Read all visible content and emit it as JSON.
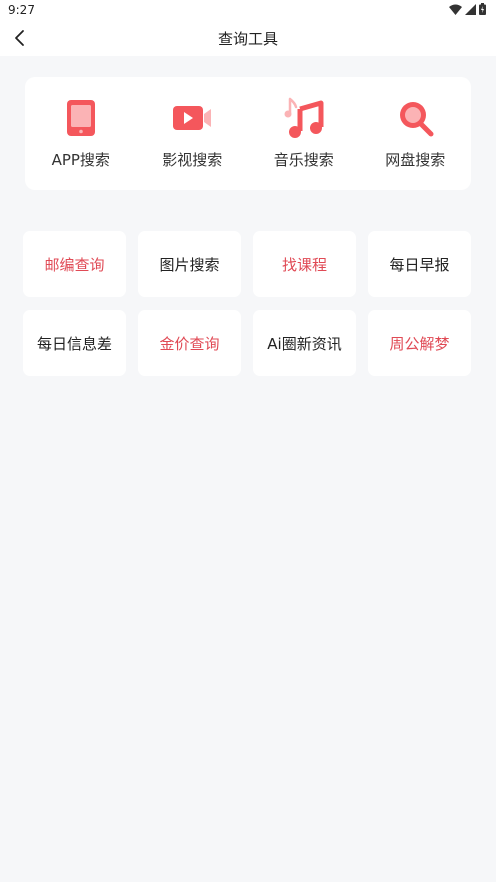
{
  "status": {
    "time": "9:27"
  },
  "nav": {
    "title": "查询工具"
  },
  "colors": {
    "accent": "#e04a55",
    "dark": "#222222"
  },
  "tools": [
    {
      "label": "APP搜索",
      "icon": "tablet-icon"
    },
    {
      "label": "影视搜索",
      "icon": "video-camera-icon"
    },
    {
      "label": "音乐搜索",
      "icon": "music-note-icon"
    },
    {
      "label": "网盘搜索",
      "icon": "search-icon"
    }
  ],
  "grid": [
    {
      "label": "邮编查询",
      "highlight": true
    },
    {
      "label": "图片搜索",
      "highlight": false
    },
    {
      "label": "找课程",
      "highlight": true
    },
    {
      "label": "每日早报",
      "highlight": false
    },
    {
      "label": "每日信息差",
      "highlight": false
    },
    {
      "label": "金价查询",
      "highlight": true
    },
    {
      "label": "Ai圈新资讯",
      "highlight": false
    },
    {
      "label": "周公解梦",
      "highlight": true
    }
  ]
}
